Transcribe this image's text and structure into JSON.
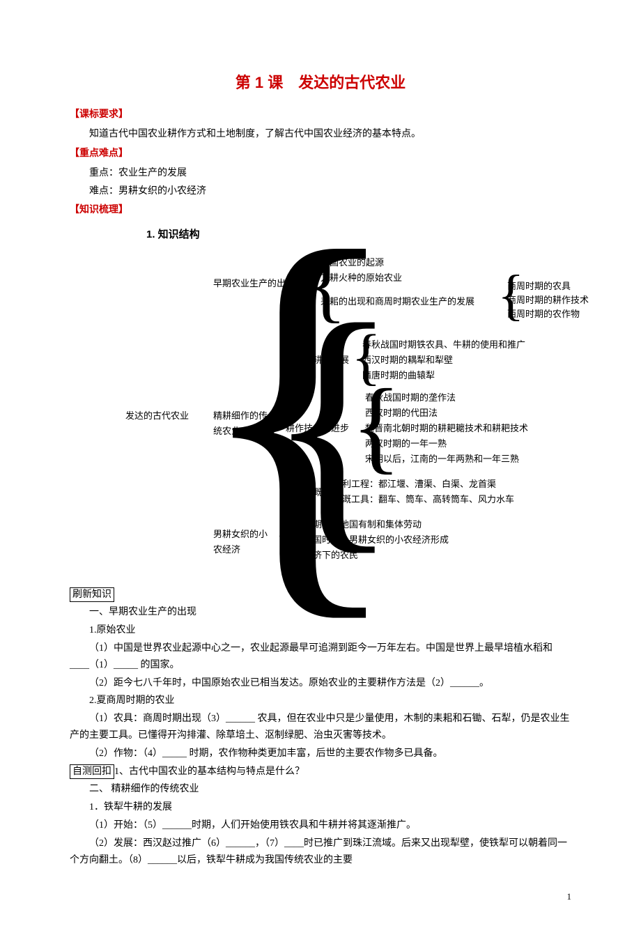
{
  "title": "第 1 课　发达的古代农业",
  "sections": {
    "s1": "【课标要求】",
    "s1_body": "知道古代中国农业耕作方式和土地制度，了解古代中国农业经济的基本特点。",
    "s2": "【重点难点】",
    "s2_1": "重点：农业生产的发展",
    "s2_2": "难点：男耕女织的小农经济",
    "s3": "【知识梳理】",
    "kstruct_title": "1. 知识结构"
  },
  "structure": {
    "root": "发达的古代农业",
    "a": "早期农业生产的出现",
    "a1": "中国农业的起源",
    "a2": "刀耕火种的原始农业",
    "a3": "耒耜的出现和商周时期农业生产的发展",
    "a3_1": "商周时期的农具",
    "a3_2": "商周时期的耕作技术",
    "a3_3": "西周时期的农作物",
    "b": "精耕细作的传统农业",
    "b1": "铁犁牛耕的发展",
    "b1_1": "春秋战国时期铁农具、牛耕的使用和推广",
    "b1_2": "西汉时期的耦犁和犁壁",
    "b1_3": "隋唐时期的曲辕犁",
    "b2": "耕作技术的进步",
    "b2_1": "春秋战国时期的垄作法",
    "b2_2": "西汉时期的代田法",
    "b2_3": "魏晋南北朝时期的耕耙耱技术和耕耙技术",
    "b2_4": "两汉时期的一年一熟",
    "b2_5": "宋朝以后，江南的一年两熟和一年三熟",
    "b3": "水利灌溉",
    "b3_1": "水利工程：都江堰、漕渠、白渠、龙首渠",
    "b3_2": "灌溉工具：翻车、筒车、高转筒车、风力水车",
    "c": "男耕女织的小农经济",
    "c1": "商周时期的土地国有制和集体劳动",
    "c2": "春秋战国时期，男耕女织的小农经济形成",
    "c3": "小农经济下的农民"
  },
  "refresh": {
    "label": "刷新知识",
    "h1": "一、早期农业生产的出现",
    "h1_1": "1.原始农业",
    "p1": "（1）中国是世界农业起源中心之一，农业起源最早可追溯到距今一万年左右。中国是世界上最早培植水稻和____（1）_____ 的国家。",
    "p2": "（2）距今七八千年时，中国原始农业已相当发达。原始农业的主要耕作方法是（2）______。",
    "h1_2": "2.夏商周时期的农业",
    "p3": "（1）农具：商周时期出现（3）______ 农具，但在农业中只是少量使用，木制的耒耜和石锄、石犁，仍是农业生产的主要工具。已懂得开沟排灌、除草培土、沤制绿肥、治虫灭害等技术。",
    "p4": "（2）作物：（4）_____ 时期，农作物种类更加丰富，后世的主要农作物多已具备。",
    "test_label": "自测回扣",
    "test_q": "1、古代中国农业的基本结构与特点是什么？",
    "h2": "二、 精耕细作的传统农业",
    "h2_1": "1．铁犁牛耕的发展",
    "p5": "（1）开始：（5）______时期，人们开始使用铁农具和牛耕并将其逐渐推广。",
    "p6": "（2）发展：西汉赵过推广（6）______，（7）____时已推广到珠江流域。后来又出现犁壁，使铁犁可以朝着同一个方向翻土。（8）______以后，铁犁牛耕成为我国传统农业的主要"
  },
  "page_number": "1"
}
